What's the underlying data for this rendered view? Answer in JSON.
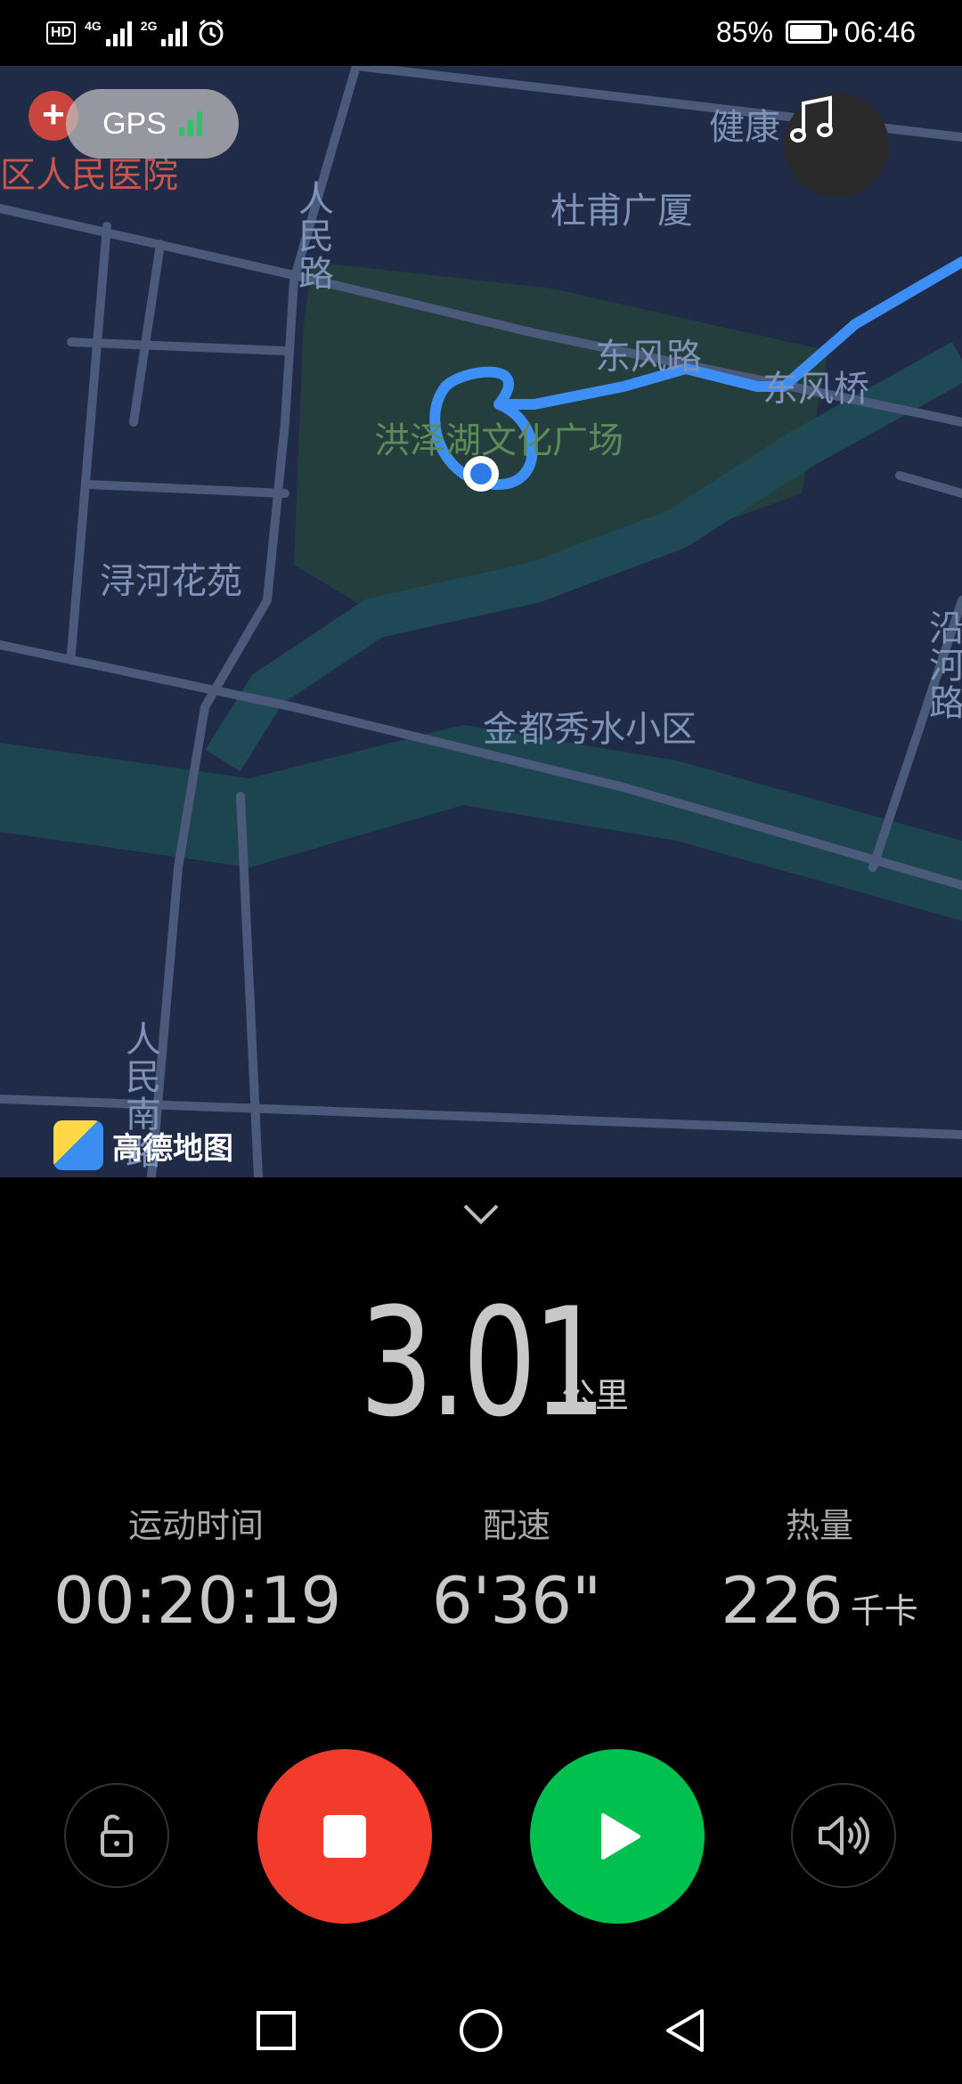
{
  "status_bar": {
    "hd": "HD",
    "net1": "4G",
    "net2": "2G",
    "battery_percent_text": "85%",
    "battery_level": 0.85,
    "time": "06:46",
    "icons": [
      "hd-icon",
      "signal-4g-icon",
      "signal-2g-icon",
      "alarm-icon",
      "battery-icon"
    ]
  },
  "map": {
    "gps_label": "GPS",
    "gps_signal_bars": 3,
    "labels": {
      "hospital": "区人民医院",
      "health": "健康",
      "dufu": "杜甫广厦",
      "renmin_road": "人民路",
      "dongfeng_road": "东风路",
      "dongfeng_bridge": "东风桥",
      "square": "洪泽湖文化广场",
      "xunhe": "浔河花苑",
      "yanhe_road": "沿河路",
      "jindu": "金都秀水小区",
      "renmin_south": "人民南路"
    },
    "provider": "高德地图",
    "route_color": "#3d8ef5",
    "icons": [
      "hospital-icon",
      "music-icon",
      "location-dot-icon",
      "amap-logo-icon"
    ]
  },
  "workout": {
    "distance": "3.01",
    "distance_unit": "公里",
    "stats": [
      {
        "label": "运动时间",
        "value": "00:20:19",
        "unit": ""
      },
      {
        "label": "配速",
        "value": "6'36\"",
        "unit": ""
      },
      {
        "label": "热量",
        "value": "226",
        "unit": "千卡"
      }
    ]
  },
  "controls": {
    "stop_color": "#f23b2b",
    "play_color": "#00c150",
    "icons": [
      "lock-icon",
      "stop-icon",
      "play-icon",
      "volume-icon"
    ]
  },
  "nav": {
    "icons": [
      "recents-icon",
      "home-icon",
      "back-icon"
    ]
  }
}
